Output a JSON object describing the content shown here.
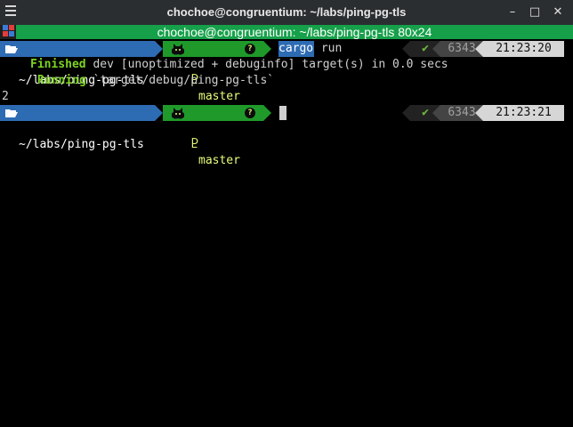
{
  "window": {
    "title": "chochoe@congruentium: ~/labs/ping-pg-tls",
    "controls": {
      "minimize": "–",
      "maximize": "□",
      "close": "✕"
    }
  },
  "tab": {
    "title": "chochoe@congruentium: ~/labs/ping-pg-tls 80x24"
  },
  "prompt1": {
    "path": "~/labs/ping-pg-tls",
    "branch": "master",
    "status": "✔",
    "history": "6343",
    "time": "21:23:20"
  },
  "command": {
    "program": "cargo",
    "args": " run"
  },
  "output": {
    "finished_label": "Finished",
    "finished_text": " dev [unoptimized + debuginfo] target(s) in 0.0 secs",
    "running_label": "Running",
    "running_text": " `target/debug/ping-pg-tls`",
    "result": "2"
  },
  "prompt2": {
    "path": "~/labs/ping-pg-tls",
    "branch": "master",
    "status": "✔",
    "history": "6343",
    "time": "21:23:21"
  },
  "colors": {
    "path_bg": "#2d6bb3",
    "git_bg": "#1f9a2a",
    "tab_bg": "#16a04a",
    "success": "#7ed321"
  },
  "icons": {
    "folder": "folder-open-icon",
    "github": "github-octocat-icon",
    "branch": "git-branch-icon",
    "question": "question-circle-icon"
  }
}
